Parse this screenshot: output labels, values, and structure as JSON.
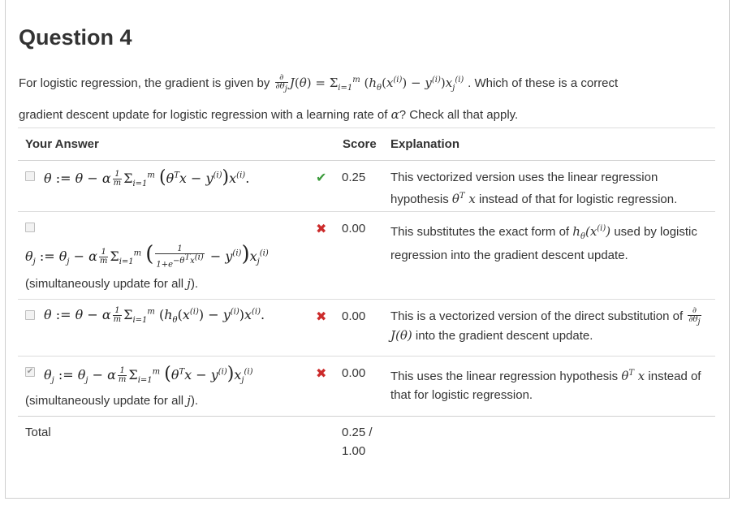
{
  "question": {
    "title": "Question 4",
    "intro_text": "For logistic regression, the gradient is given by",
    "formula": "∂/∂θj J(θ) = Σi=1m (hθ(x(i)) − y(i)) xj(i)",
    "followup_text": ". Which of these is a correct",
    "line2_text": "gradient descent update for logistic regression with a learning rate of",
    "alpha": "α",
    "line2_end": "? Check all that apply."
  },
  "table": {
    "headers": {
      "answer": "Your Answer",
      "score": "Score",
      "explanation": "Explanation"
    },
    "rows": [
      {
        "formula": "θ := θ − α (1/m) Σi=1m (θT x − y(i)) x(i).",
        "subtext": "",
        "checked": false,
        "status": "correct",
        "score": "0.25",
        "explanation": "This vectorized version uses the linear regression hypothesis θT x instead of that for logistic regression."
      },
      {
        "formula": "θj := θj − α (1/m) Σi=1m ( 1/(1+e−θT x(i)) − y(i) ) xj(i)",
        "subtext": "(simultaneously update for all j).",
        "checked": false,
        "status": "incorrect",
        "score": "0.00",
        "explanation": "This substitutes the exact form of hθ(x(i)) used by logistic regression into the gradient descent update."
      },
      {
        "formula": "θ := θ − α (1/m) Σi=1m (hθ(x(i)) − y(i)) x(i).",
        "subtext": "",
        "checked": false,
        "status": "incorrect",
        "score": "0.00",
        "explanation": "This is a vectorized version of the direct substitution of ∂/∂θj J(θ) into the gradient descent update."
      },
      {
        "formula": "θj := θj − α (1/m) Σi=1m (θT x − y(i)) xj(i)",
        "subtext": "(simultaneously update for all j).",
        "checked": true,
        "status": "incorrect",
        "score": "0.00",
        "explanation": "This uses the linear regression hypothesis θT x instead of that for logistic regression."
      }
    ],
    "total": {
      "label": "Total",
      "score_line1": "0.25 /",
      "score_line2": "1.00"
    }
  },
  "marks": {
    "correct": "✔",
    "incorrect": "✖",
    "checkbox_checked": "✔"
  },
  "colors": {
    "correct": "#3c9b3c",
    "incorrect": "#cc2b2b",
    "border": "#dddddd"
  }
}
